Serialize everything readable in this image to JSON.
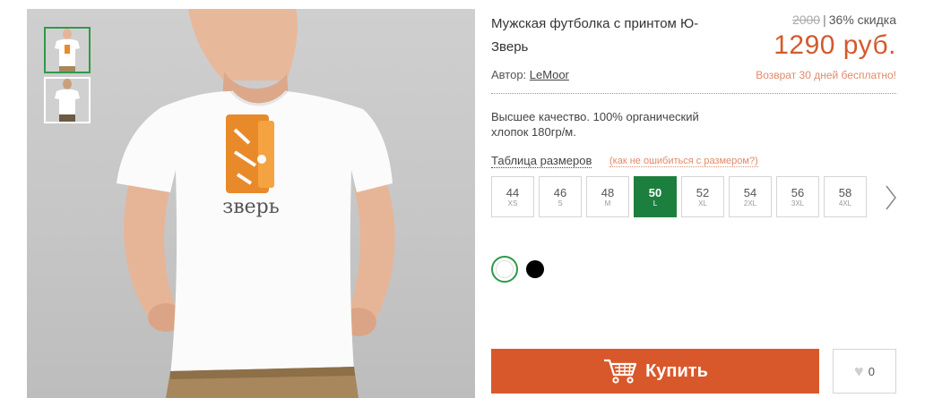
{
  "product": {
    "title": "Мужская футболка с принтом Ю-Зверь",
    "old_price": "2000",
    "discount": "36% скидка",
    "price": "1290 руб.",
    "author_label": "Автор:",
    "author_name": "LeMoor",
    "return_note": "Возврат 30 дней бесплатно!",
    "description": "Высшее качество. 100% органический хлопок 180гр/м.",
    "print_text": "зверь"
  },
  "sizes": {
    "table_label": "Таблица размеров",
    "help_label": "(как не ошибиться с размером?)",
    "items": [
      {
        "num": "44",
        "label": "XS"
      },
      {
        "num": "46",
        "label": "S"
      },
      {
        "num": "48",
        "label": "M"
      },
      {
        "num": "50",
        "label": "L"
      },
      {
        "num": "52",
        "label": "XL"
      },
      {
        "num": "54",
        "label": "2XL"
      },
      {
        "num": "56",
        "label": "3XL"
      },
      {
        "num": "58",
        "label": "4XL"
      }
    ],
    "selected": "50"
  },
  "colors": [
    {
      "name": "white",
      "hex": "#ffffff",
      "selected": true
    },
    {
      "name": "black",
      "hex": "#000000",
      "selected": false
    }
  ],
  "actions": {
    "buy_label": "Купить",
    "like_count": "0"
  },
  "theme": {
    "accent": "#d9582b",
    "selected_green": "#1d7f3e"
  }
}
